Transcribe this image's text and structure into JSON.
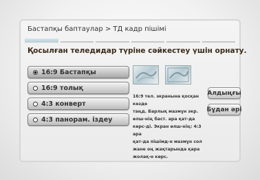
{
  "header": {
    "title": "Бастапқы баптаулар > ТД кадр пішімі",
    "progress_segments": 6,
    "progress_active_index": 0
  },
  "instruction": "Қосылған теледидар түріне сәйкестеу үшін орнату.",
  "options": [
    {
      "label": "16:9 Бастапқы",
      "selected": true
    },
    {
      "label": "16:9 толық",
      "selected": false
    },
    {
      "label": "4:3 конверт",
      "selected": false
    },
    {
      "label": "4:3 панорам. іздеу",
      "selected": false
    }
  ],
  "description": "16:9 тел. экранына қосқан кезде\nтаңд. Барлық мазмұн экр.\nөлш-нің баст. ара қат-да\nкөрс-ді. Экран өлш-нің: 4:3 ара\nқат-да пішімд-н мазмұн сол\nжане оң жақтарында қара\nжолақ-н көрс.",
  "buttons": {
    "previous": "Алдыңғы",
    "next": "Бұдан әрі"
  },
  "colors": {
    "panel_border": "#d6d6d6",
    "text": "#333333",
    "progress_active": "#c4d6dd"
  }
}
